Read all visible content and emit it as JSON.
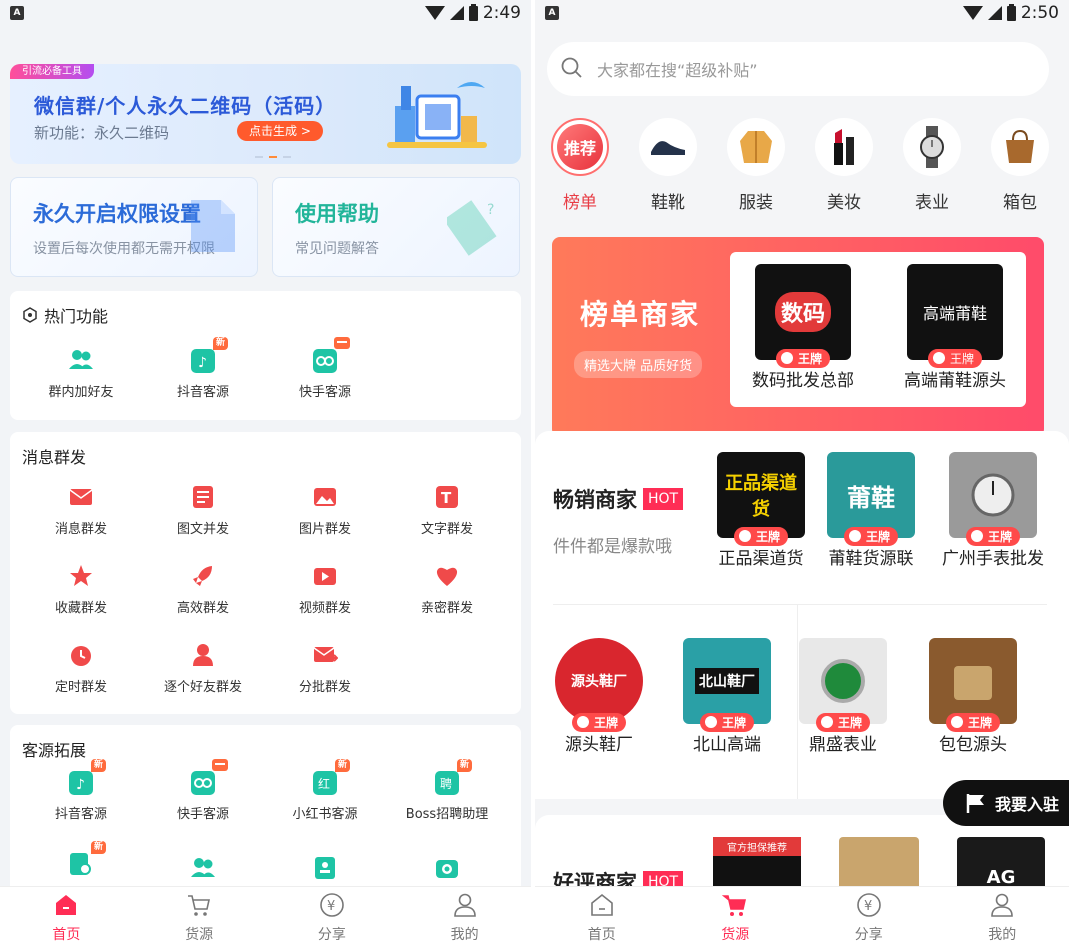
{
  "left": {
    "status": {
      "time": "2:49"
    },
    "banner": {
      "tag": "引流必备工具",
      "title": "微信群/个人永久二维码（活码）",
      "subtitle": "新功能：永久二维码",
      "button": "点击生成 >"
    },
    "cards": [
      {
        "title": "永久开启权限设置",
        "subtitle": "设置后每次使用都无需开权限",
        "color": "#2c6bd8"
      },
      {
        "title": "使用帮助",
        "subtitle": "常见问题解答",
        "color": "#22b59a"
      }
    ],
    "hot": {
      "title": "热门功能",
      "items": [
        "群内加好友",
        "抖音客源",
        "快手客源"
      ]
    },
    "broadcast": {
      "title": "消息群发",
      "items": [
        "消息群发",
        "图文并发",
        "图片群发",
        "文字群发",
        "收藏群发",
        "高效群发",
        "视频群发",
        "亲密群发",
        "定时群发",
        "逐个好友群发",
        "分批群发"
      ]
    },
    "expand": {
      "title": "客源拓展",
      "items": [
        "抖音客源",
        "快手客源",
        "小红书客源",
        "Boss招聘助理"
      ],
      "new_badge": "新"
    },
    "tabs": [
      "首页",
      "货源",
      "分享",
      "我的"
    ]
  },
  "right": {
    "status": {
      "time": "2:50"
    },
    "search_placeholder": "大家都在搜“超级补贴”",
    "categories": [
      "榜单",
      "鞋靴",
      "服装",
      "美妆",
      "表业",
      "箱包"
    ],
    "tui_label": "推荐",
    "rank": {
      "title": "榜单商家",
      "subtitle": "精选大牌 品质好货",
      "merchants": [
        {
          "name": "数码批发总部",
          "logo": "数码"
        },
        {
          "name": "高端莆鞋源头",
          "logo": "高端莆鞋"
        }
      ]
    },
    "wangpai": "王牌",
    "bestseller": {
      "title": "畅销商家",
      "hot": "HOT",
      "subtitle": "件件都是爆款哦",
      "merchants": [
        {
          "name": "正品渠道货",
          "logo": "正品渠道货"
        },
        {
          "name": "莆鞋货源联",
          "logo": "莆鞋"
        },
        {
          "name": "广州手表批发",
          "logo": ""
        }
      ],
      "row2": [
        {
          "name": "源头鞋厂",
          "logo": "源头鞋厂"
        },
        {
          "name": "北山高端",
          "logo": "北山鞋厂"
        },
        {
          "name": "鼎盛表业",
          "logo": ""
        },
        {
          "name": "包包源头",
          "logo": ""
        }
      ]
    },
    "good": {
      "title": "好评商家",
      "hot": "HOT",
      "logo1_tag": "官方担保推荐",
      "logo3": "AG"
    },
    "join": "我要入驻",
    "tabs": [
      "首页",
      "货源",
      "分享",
      "我的"
    ]
  }
}
